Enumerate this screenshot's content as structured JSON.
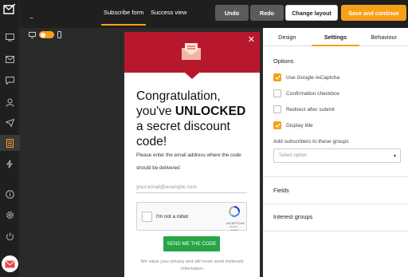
{
  "topbar": {
    "tabs": [
      "Subscribe form",
      "Success view"
    ],
    "undo": "Undo",
    "redo": "Redo",
    "change_layout": "Change layout",
    "save": "Save and continue"
  },
  "popup": {
    "title_pre": "Congratulation, you've ",
    "title_bold": "UNLOCKED",
    "title_post": " a secret discount code!",
    "subtitle": "Please enter the email address where the code should be delivered",
    "email_placeholder": "your.email@example.com",
    "captcha_label": "I'm not a robot",
    "captcha_brand": "reCAPTCHA",
    "captcha_links": "Privacy - Terms",
    "button": "SEND ME THE CODE",
    "privacy": "We value your privacy and will never send irrelevant information"
  },
  "panel": {
    "tabs": [
      "Design",
      "Settings",
      "Behaviour"
    ],
    "options_title": "Options",
    "options": [
      {
        "label": "Use Google reCaptcha",
        "checked": true
      },
      {
        "label": "Confirmation checkbox",
        "checked": false
      },
      {
        "label": "Redirect after submit",
        "checked": false
      },
      {
        "label": "Display title",
        "checked": true
      }
    ],
    "groups_label": "Add subscribers to these groups",
    "select_placeholder": "Select option",
    "fields": "Fields",
    "interest_groups": "Interest groups"
  },
  "colors": {
    "accent": "#f6a01a",
    "header_red": "#b8182e",
    "send_green": "#27a546"
  }
}
